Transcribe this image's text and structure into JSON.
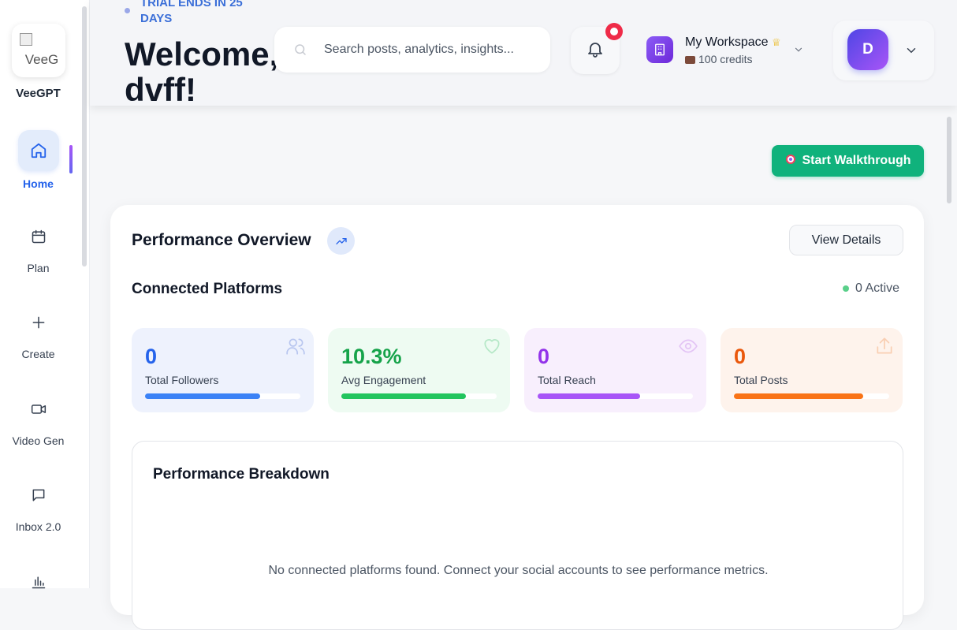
{
  "brand": {
    "name": "VeeGPT",
    "logo_alt": "VeeG"
  },
  "nav": [
    {
      "label": "Home",
      "icon": "home-icon",
      "active": true
    },
    {
      "label": "Plan",
      "icon": "calendar-icon"
    },
    {
      "label": "Create",
      "icon": "plus-icon"
    },
    {
      "label": "Video Gen",
      "icon": "video-icon"
    },
    {
      "label": "Inbox 2.0",
      "icon": "chat-icon"
    },
    {
      "label": "",
      "icon": "bar-chart-icon"
    }
  ],
  "header": {
    "trial": "TRIAL ENDS IN 25 DAYS",
    "welcome": "Welcome, dvff!",
    "search_placeholder": "Search posts, analytics, insights...",
    "workspace_name": "My Workspace",
    "credits": "100 credits",
    "avatar_initial": "D"
  },
  "walkthrough_label": "Start Walkthrough",
  "performance": {
    "title": "Performance Overview",
    "view_details": "View Details",
    "connected_title": "Connected Platforms",
    "active_label": "0 Active",
    "stats": [
      {
        "value": "0",
        "label": "Total Followers",
        "progress": 0.74,
        "color": "#3b82f6",
        "num_color": "#2563eb",
        "bg": "#eef2fd",
        "icon": "users-icon"
      },
      {
        "value": "10.3%",
        "label": "Avg Engagement",
        "progress": 0.8,
        "color": "#22c55e",
        "num_color": "#16a34a",
        "bg": "#eefbf2",
        "icon": "heart-icon"
      },
      {
        "value": "0",
        "label": "Total Reach",
        "progress": 0.66,
        "color": "#a855f7",
        "num_color": "#9333ea",
        "bg": "#f8effd",
        "icon": "eye-icon"
      },
      {
        "value": "0",
        "label": "Total Posts",
        "progress": 0.83,
        "color": "#f97316",
        "num_color": "#ea580c",
        "bg": "#fef3ec",
        "icon": "share-icon"
      }
    ],
    "breakdown_title": "Performance Breakdown",
    "breakdown_empty": "No connected platforms found. Connect your social accounts to see performance metrics."
  }
}
